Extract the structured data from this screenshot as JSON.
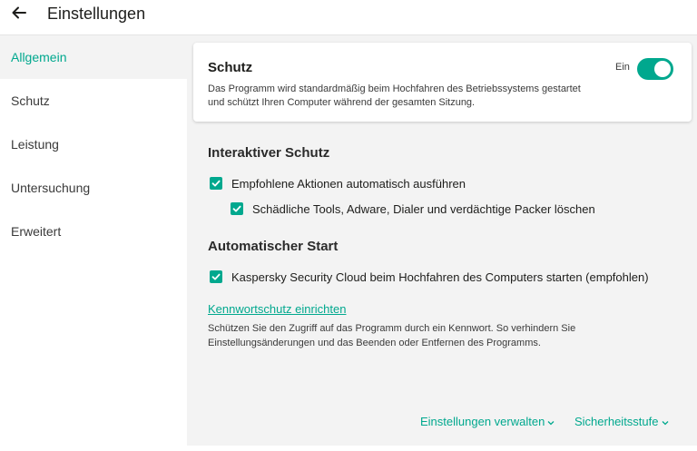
{
  "header": {
    "title": "Einstellungen",
    "back_icon": "arrow-left-icon"
  },
  "sidebar": {
    "items": [
      {
        "label": "Allgemein",
        "active": true
      },
      {
        "label": "Schutz"
      },
      {
        "label": "Leistung"
      },
      {
        "label": "Untersuchung"
      },
      {
        "label": "Erweitert"
      }
    ]
  },
  "protection_card": {
    "title": "Schutz",
    "description": "Das Programm wird standardmäßig beim Hochfahren des Betriebssystems gestartet und schützt Ihren Computer während der gesamten Sitzung.",
    "toggle_label": "Ein",
    "toggle_on": true
  },
  "interactive": {
    "title": "Interaktiver Schutz",
    "opt1": "Empfohlene Aktionen automatisch ausführen",
    "opt2": "Schädliche Tools, Adware, Dialer und verdächtige Packer löschen"
  },
  "autostart": {
    "title": "Automatischer Start",
    "opt1": "Kaspersky Security Cloud beim Hochfahren des Computers starten (empfohlen)"
  },
  "password": {
    "link": "Kennwortschutz einrichten",
    "description": "Schützen Sie den Zugriff auf das Programm durch ein Kennwort. So verhindern Sie Einstellungsänderungen und das Beenden oder Entfernen des Programms."
  },
  "footer": {
    "manage": "Einstellungen verwalten",
    "security_level": "Sicherheitsstufe"
  },
  "colors": {
    "accent": "#00a88e",
    "background": "#f3f3f3"
  }
}
